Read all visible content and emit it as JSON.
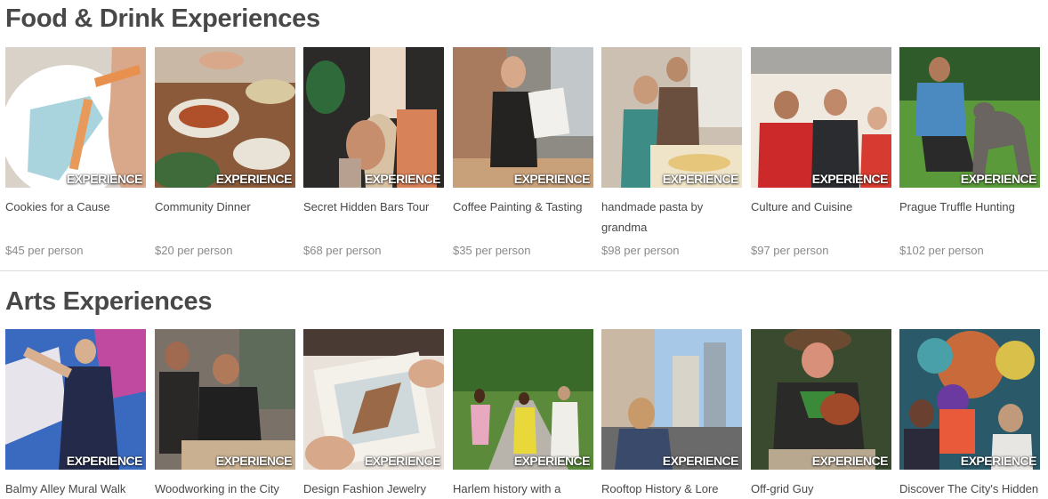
{
  "sections": [
    {
      "title": "Food & Drink Experiences",
      "cards": [
        {
          "title": "Cookies for a Cause",
          "price": "$45 per person",
          "badge": "EXPERIENCE"
        },
        {
          "title": "Community Dinner",
          "price": "$20 per person",
          "badge": "EXPERIENCE"
        },
        {
          "title": "Secret Hidden Bars Tour",
          "price": "$68 per person",
          "badge": "EXPERIENCE"
        },
        {
          "title": "Coffee Painting & Tasting",
          "price": "$35 per person",
          "badge": "EXPERIENCE"
        },
        {
          "title": "handmade pasta by grandma",
          "price": "$98 per person",
          "badge": "EXPERIENCE"
        },
        {
          "title": "Culture and Cuisine",
          "price": "$97 per person",
          "badge": "EXPERIENCE"
        },
        {
          "title": "Prague Truffle Hunting",
          "price": "$102 per person",
          "badge": "EXPERIENCE"
        }
      ]
    },
    {
      "title": "Arts Experiences",
      "cards": [
        {
          "title": "Balmy Alley Mural Walk",
          "badge": "EXPERIENCE"
        },
        {
          "title": "Woodworking in the City",
          "badge": "EXPERIENCE"
        },
        {
          "title": "Design Fashion Jewelry",
          "badge": "EXPERIENCE"
        },
        {
          "title": "Harlem history with a",
          "badge": "EXPERIENCE"
        },
        {
          "title": "Rooftop History & Lore",
          "badge": "EXPERIENCE"
        },
        {
          "title": "Off-grid Guy",
          "badge": "EXPERIENCE"
        },
        {
          "title": "Discover The City's Hidden",
          "badge": "EXPERIENCE"
        }
      ]
    }
  ]
}
